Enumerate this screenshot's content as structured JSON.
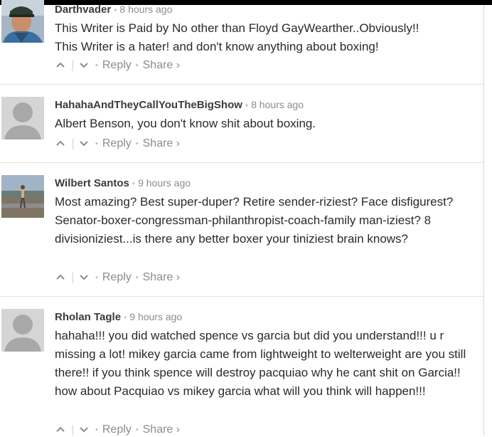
{
  "comments": [
    {
      "username": "Darthvader",
      "time": "8 hours ago",
      "text": [
        "This Writer is Paid by No other than Floyd GayWearther..Obviously!!",
        "This Writer is a hater! and don't know anything about boxing!"
      ],
      "reply": "Reply",
      "share": "Share ›"
    },
    {
      "username": "HahahaAndTheyCallYouTheBigShow",
      "time": "8 hours ago",
      "text": [
        "Albert Benson, you don't know shit about boxing."
      ],
      "reply": "Reply",
      "share": "Share ›"
    },
    {
      "username": "Wilbert Santos",
      "time": "9 hours ago",
      "text": [
        "Most amazing? Best super-duper? Retire sender-riziest? Face disfigurest? Senator-boxer-congressman-philanthropist-coach-family man-iziest? 8 divisioniziest...is there any better boxer your tiniziest brain knows?"
      ],
      "reply": "Reply",
      "share": "Share ›"
    },
    {
      "username": "Rholan Tagle",
      "time": "9 hours ago",
      "text": [
        "hahaha!!! you did watched spence vs garcia but did you understand!!! u r missing a lot! mikey garcia came from lightweight to welterweight are you still there!! if you think spence will destroy pacquiao why he cant shit on Garcia!! how about Pacquiao vs mikey garcia what will you think will happen!!!"
      ],
      "reply": "Reply",
      "share": "Share ›"
    }
  ],
  "icons": {
    "upvote": "chevron-up-icon",
    "downvote": "chevron-down-icon",
    "avatar_placeholder": "user-silhouette-icon"
  },
  "colors": {
    "text": "#2a2a2a",
    "meta": "#8c8c8c",
    "placeholder_bg": "#d5d5d5",
    "placeholder_fg": "#a8a8a8"
  }
}
